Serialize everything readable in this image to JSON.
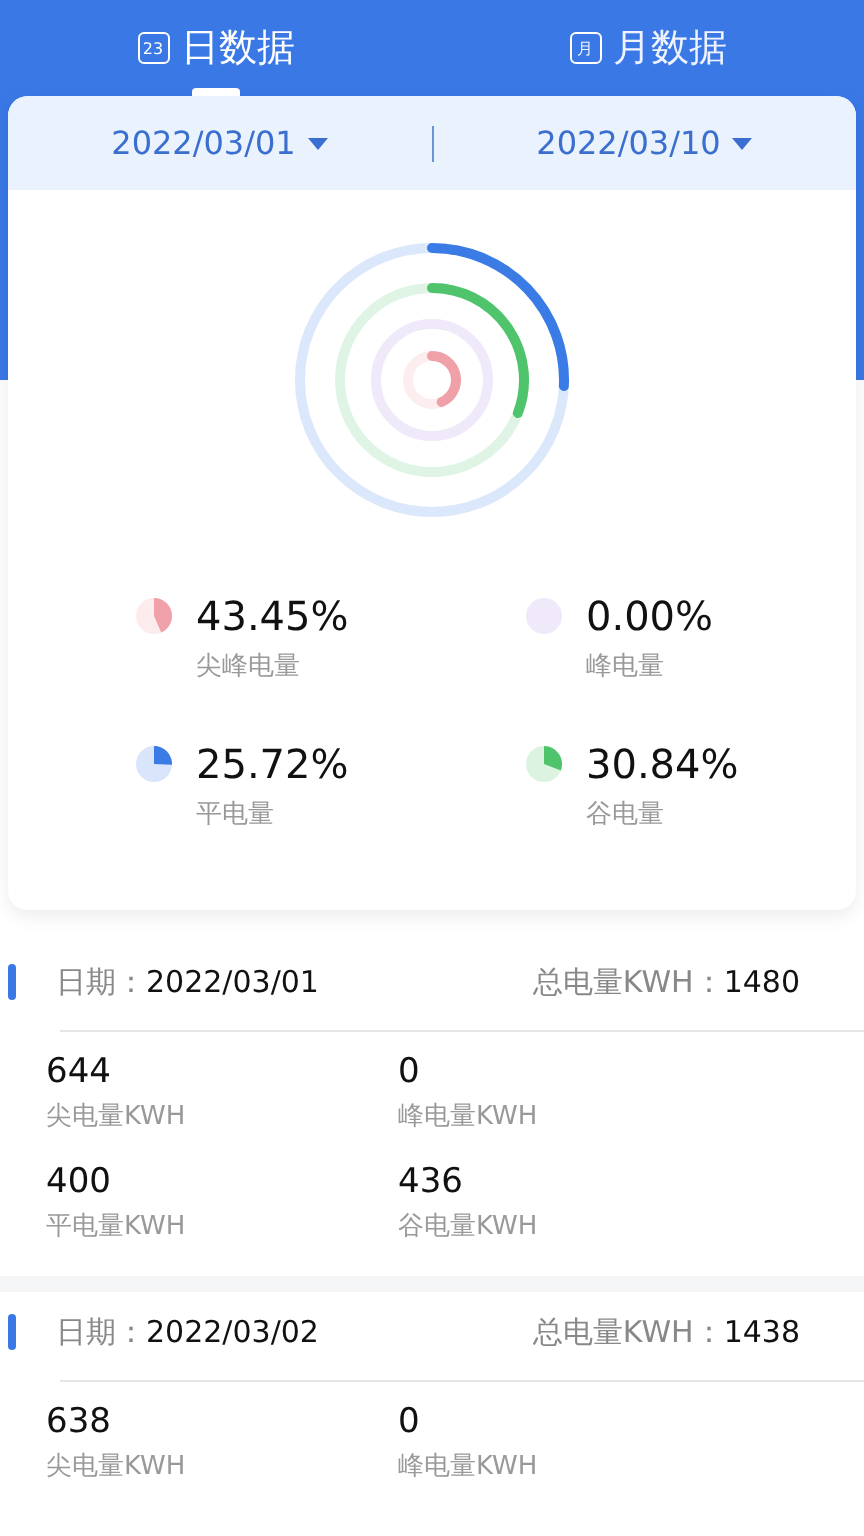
{
  "tabs": [
    {
      "label": "日数据",
      "icon": "23",
      "selected": true
    },
    {
      "label": "月数据",
      "icon": "月",
      "selected": false
    }
  ],
  "date_range": {
    "start": "2022/03/01",
    "end": "2022/03/10"
  },
  "legend": [
    {
      "percent": "43.45%",
      "label": "尖峰电量",
      "color": "#f0a0a8"
    },
    {
      "percent": "0.00%",
      "label": "峰电量",
      "color": "#efe9fa"
    },
    {
      "percent": "25.72%",
      "label": "平电量",
      "color": "#3a7be6"
    },
    {
      "percent": "30.84%",
      "label": "谷电量",
      "color": "#4fc46c"
    }
  ],
  "records": [
    {
      "date_label": "日期：",
      "date": "2022/03/01",
      "total_label": "总电量KWH：",
      "total": "1480",
      "items": [
        {
          "value": "644",
          "label": "尖电量KWH"
        },
        {
          "value": "0",
          "label": "峰电量KWH"
        },
        {
          "value": "400",
          "label": "平电量KWH"
        },
        {
          "value": "436",
          "label": "谷电量KWH"
        }
      ]
    },
    {
      "date_label": "日期：",
      "date": "2022/03/02",
      "total_label": "总电量KWH：",
      "total": "1438",
      "items": [
        {
          "value": "638",
          "label": "尖电量KWH"
        },
        {
          "value": "0",
          "label": "峰电量KWH"
        }
      ]
    }
  ]
}
